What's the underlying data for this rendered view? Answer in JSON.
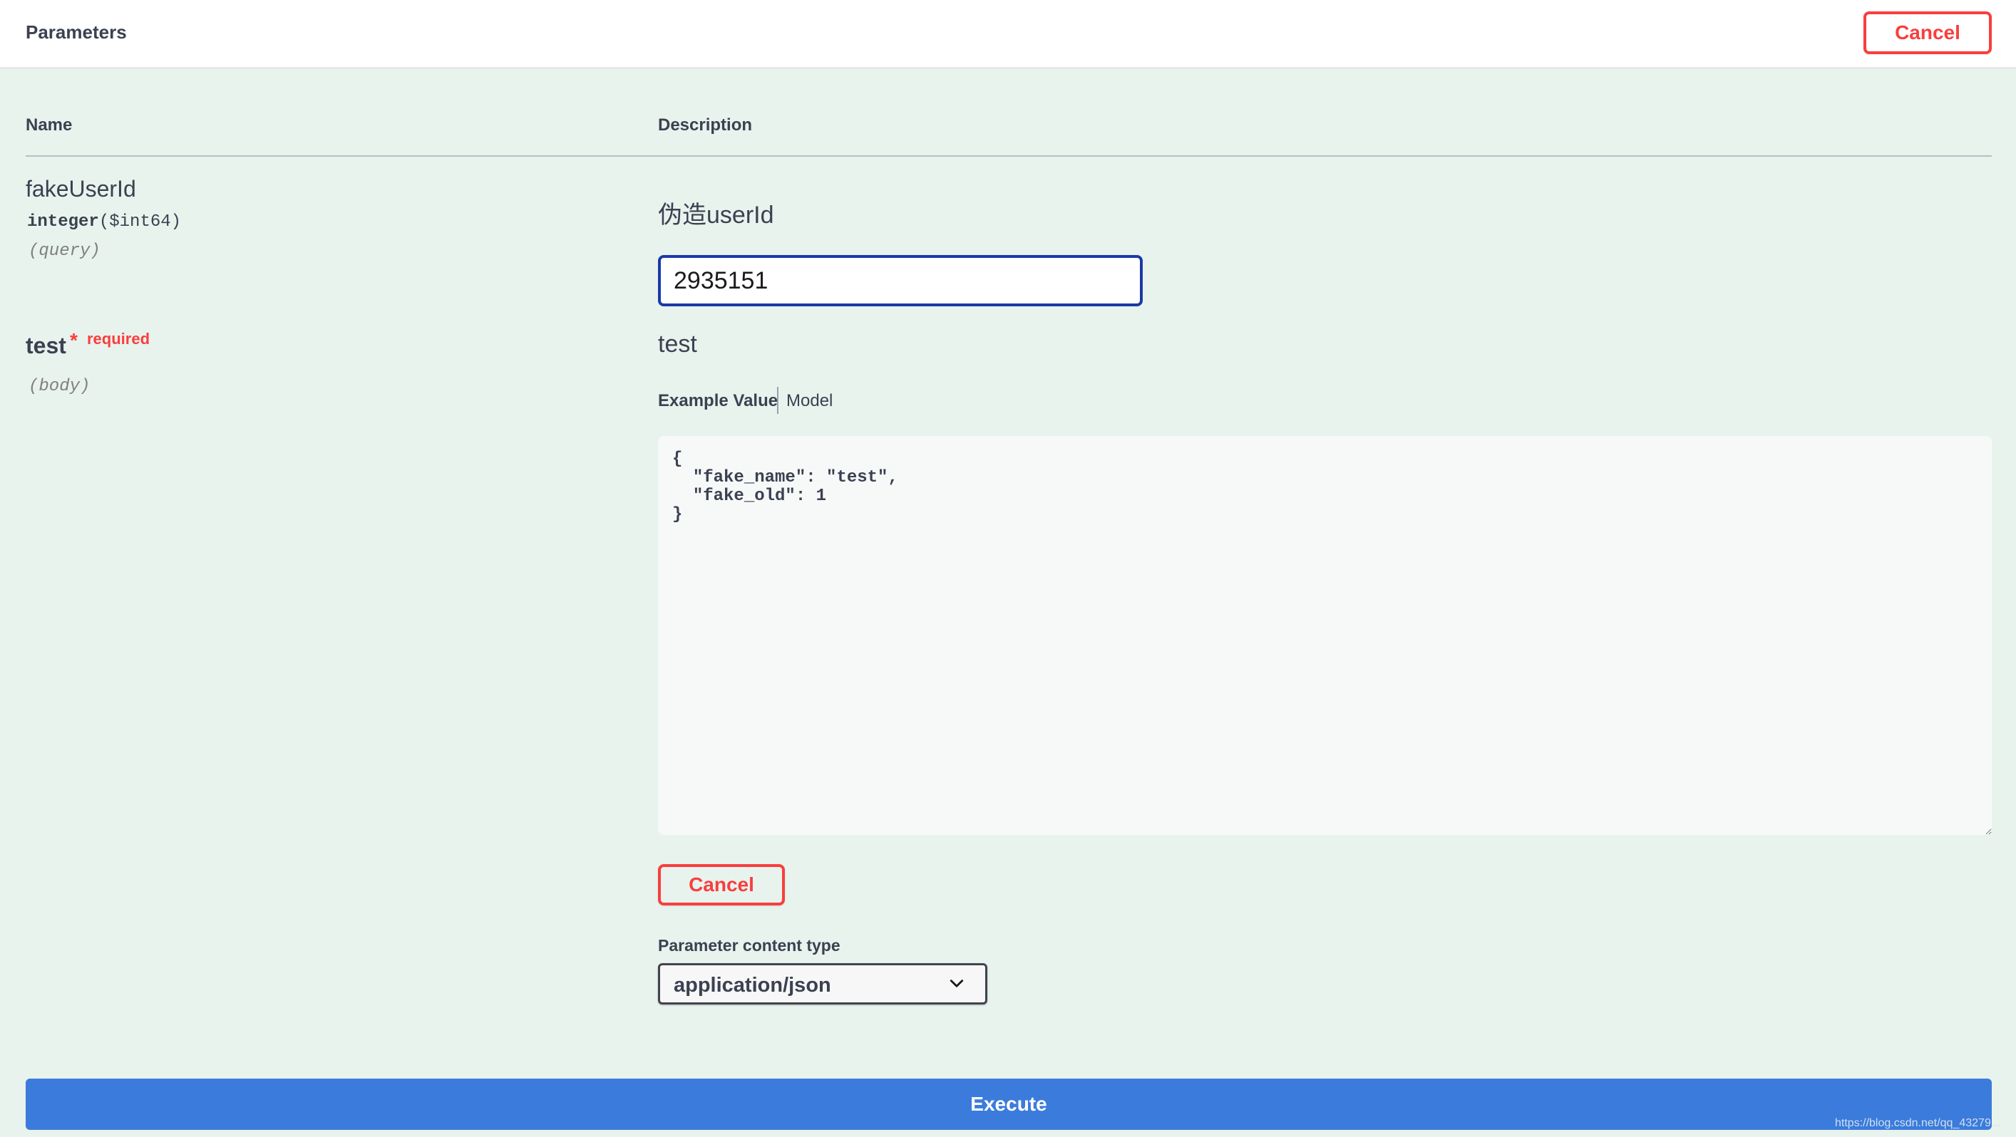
{
  "header": {
    "title": "Parameters",
    "cancel_label": "Cancel"
  },
  "columns": {
    "name": "Name",
    "description": "Description"
  },
  "params": [
    {
      "name": "fakeUserId",
      "type": "integer",
      "format": "($int64)",
      "in": "(query)",
      "description": "伪造userId",
      "value": "2935151"
    },
    {
      "name": "test",
      "required_star": "*",
      "required_label": "required",
      "in": "(body)",
      "description": "test",
      "tabs": {
        "example": "Example Value",
        "model": "Model"
      },
      "body_value": "{\n  \"fake_name\": \"test\",\n  \"fake_old\": 1\n}",
      "cancel_label": "Cancel",
      "content_type_label": "Parameter content type",
      "content_type": "application/json"
    }
  ],
  "execute_label": "Execute",
  "watermark": "https://blog.csdn.net/qq_43279...",
  "colors": {
    "cancel": "#f93e3e",
    "execute": "#3b7bdc",
    "panel": "#e8f3ed",
    "input_border": "#1a3aa8"
  },
  "icons": {
    "select_arrow": "chevron-down-icon"
  }
}
